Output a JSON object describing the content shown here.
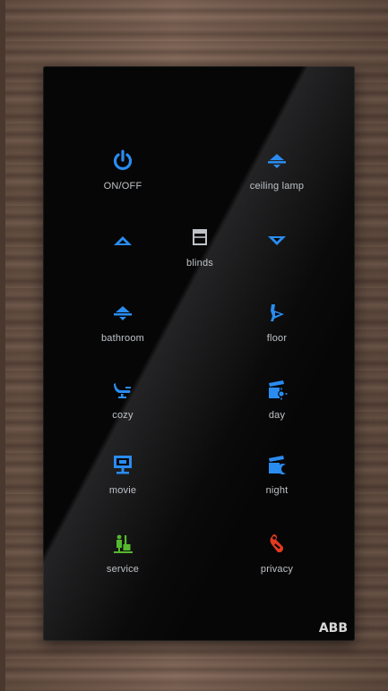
{
  "panel": {
    "brand": "ABB",
    "colors": {
      "accent": "#2a8cf0",
      "service": "#55b92e",
      "privacy": "#e23a20",
      "neutral": "#bfc3c7"
    },
    "buttons": {
      "onoff": {
        "label": "ON/OFF",
        "icon": "power-icon"
      },
      "ceiling_lamp": {
        "label": "ceiling lamp",
        "icon": "ceiling-lamp-icon"
      },
      "blinds_up": {
        "label": "",
        "icon": "arrow-up-icon"
      },
      "blinds": {
        "label": "blinds",
        "icon": "blinds-icon"
      },
      "blinds_down": {
        "label": "",
        "icon": "arrow-down-icon"
      },
      "bathroom": {
        "label": "bathroom",
        "icon": "lamp-icon"
      },
      "floor": {
        "label": "floor",
        "icon": "floor-lamp-icon"
      },
      "cozy": {
        "label": "cozy",
        "icon": "lounge-icon"
      },
      "day": {
        "label": "day",
        "icon": "scene-day-icon"
      },
      "movie": {
        "label": "movie",
        "icon": "screen-icon"
      },
      "night": {
        "label": "night",
        "icon": "scene-night-icon"
      },
      "service": {
        "label": "service",
        "icon": "cleaning-icon"
      },
      "privacy": {
        "label": "privacy",
        "icon": "do-not-disturb-icon"
      }
    }
  }
}
